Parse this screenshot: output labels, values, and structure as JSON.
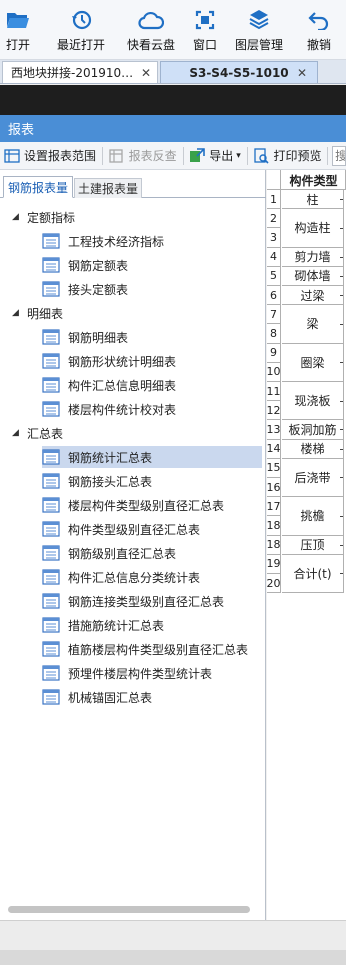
{
  "toolbar": {
    "items": [
      {
        "label": "打开",
        "icon": "folder-open-icon"
      },
      {
        "label": "最近打开",
        "icon": "clock-history-icon"
      },
      {
        "label": "快看云盘",
        "icon": "cloud-icon"
      },
      {
        "label": "窗口",
        "icon": "window-icon"
      },
      {
        "label": "图层管理",
        "icon": "layers-icon"
      },
      {
        "label": "撤销",
        "icon": "undo-icon"
      }
    ]
  },
  "tabs": [
    {
      "label": "西地块拼接-20191009…",
      "close": "✕"
    },
    {
      "label": "S3-S4-S5-1010",
      "close": "✕"
    }
  ],
  "panel": {
    "title": "报表"
  },
  "report_toolbar": {
    "set_range": "设置报表范围",
    "reverse": "报表反查",
    "export": "导出",
    "export_arrow": "▾",
    "print_preview": "打印预览",
    "search_placeholder": "搜"
  },
  "subtabs": {
    "rebar": "钢筋报表量",
    "civil": "土建报表量"
  },
  "tree": {
    "groups": [
      {
        "label": "定额指标",
        "toggle": "◢",
        "items": [
          "工程技术经济指标",
          "钢筋定额表",
          "接头定额表"
        ]
      },
      {
        "label": "明细表",
        "toggle": "◢",
        "items": [
          "钢筋明细表",
          "钢筋形状统计明细表",
          "构件汇总信息明细表",
          "楼层构件统计校对表"
        ]
      },
      {
        "label": "汇总表",
        "toggle": "◢",
        "items": [
          "钢筋统计汇总表",
          "钢筋接头汇总表",
          "楼层构件类型级别直径汇总表",
          "构件类型级别直径汇总表",
          "钢筋级别直径汇总表",
          "构件汇总信息分类统计表",
          "钢筋连接类型级别直径汇总表",
          "措施筋统计汇总表",
          "植筋楼层构件类型级别直径汇总表",
          "预埋件楼层构件类型统计表",
          "机械锚固汇总表"
        ]
      }
    ],
    "selected": "钢筋统计汇总表"
  },
  "grid": {
    "header": "构件类型",
    "rows": [
      {
        "nums": [
          "1"
        ],
        "label": "柱"
      },
      {
        "nums": [
          "2",
          "3"
        ],
        "label": "构造柱"
      },
      {
        "nums": [
          "4"
        ],
        "label": "剪力墙"
      },
      {
        "nums": [
          "5"
        ],
        "label": "砌体墙"
      },
      {
        "nums": [
          "6"
        ],
        "label": "过梁"
      },
      {
        "nums": [
          "7",
          "8"
        ],
        "label": "梁"
      },
      {
        "nums": [
          "9",
          "10"
        ],
        "label": "圈梁"
      },
      {
        "nums": [
          "11",
          "12"
        ],
        "label": "现浇板"
      },
      {
        "nums": [
          "13"
        ],
        "label": "板洞加筋"
      },
      {
        "nums": [
          "14"
        ],
        "label": "楼梯"
      },
      {
        "nums": [
          "15",
          "16"
        ],
        "label": "后浇带"
      },
      {
        "nums": [
          "17",
          "18"
        ],
        "label": "挑檐"
      },
      {
        "nums": [
          "18"
        ],
        "label": "压顶"
      },
      {
        "nums": [
          "19",
          "20"
        ],
        "label": "合计(t)"
      }
    ]
  },
  "colors": {
    "accent": "#4a8ed6",
    "selection": "#cad8ee",
    "icon_blue": "#1f6fc4"
  }
}
